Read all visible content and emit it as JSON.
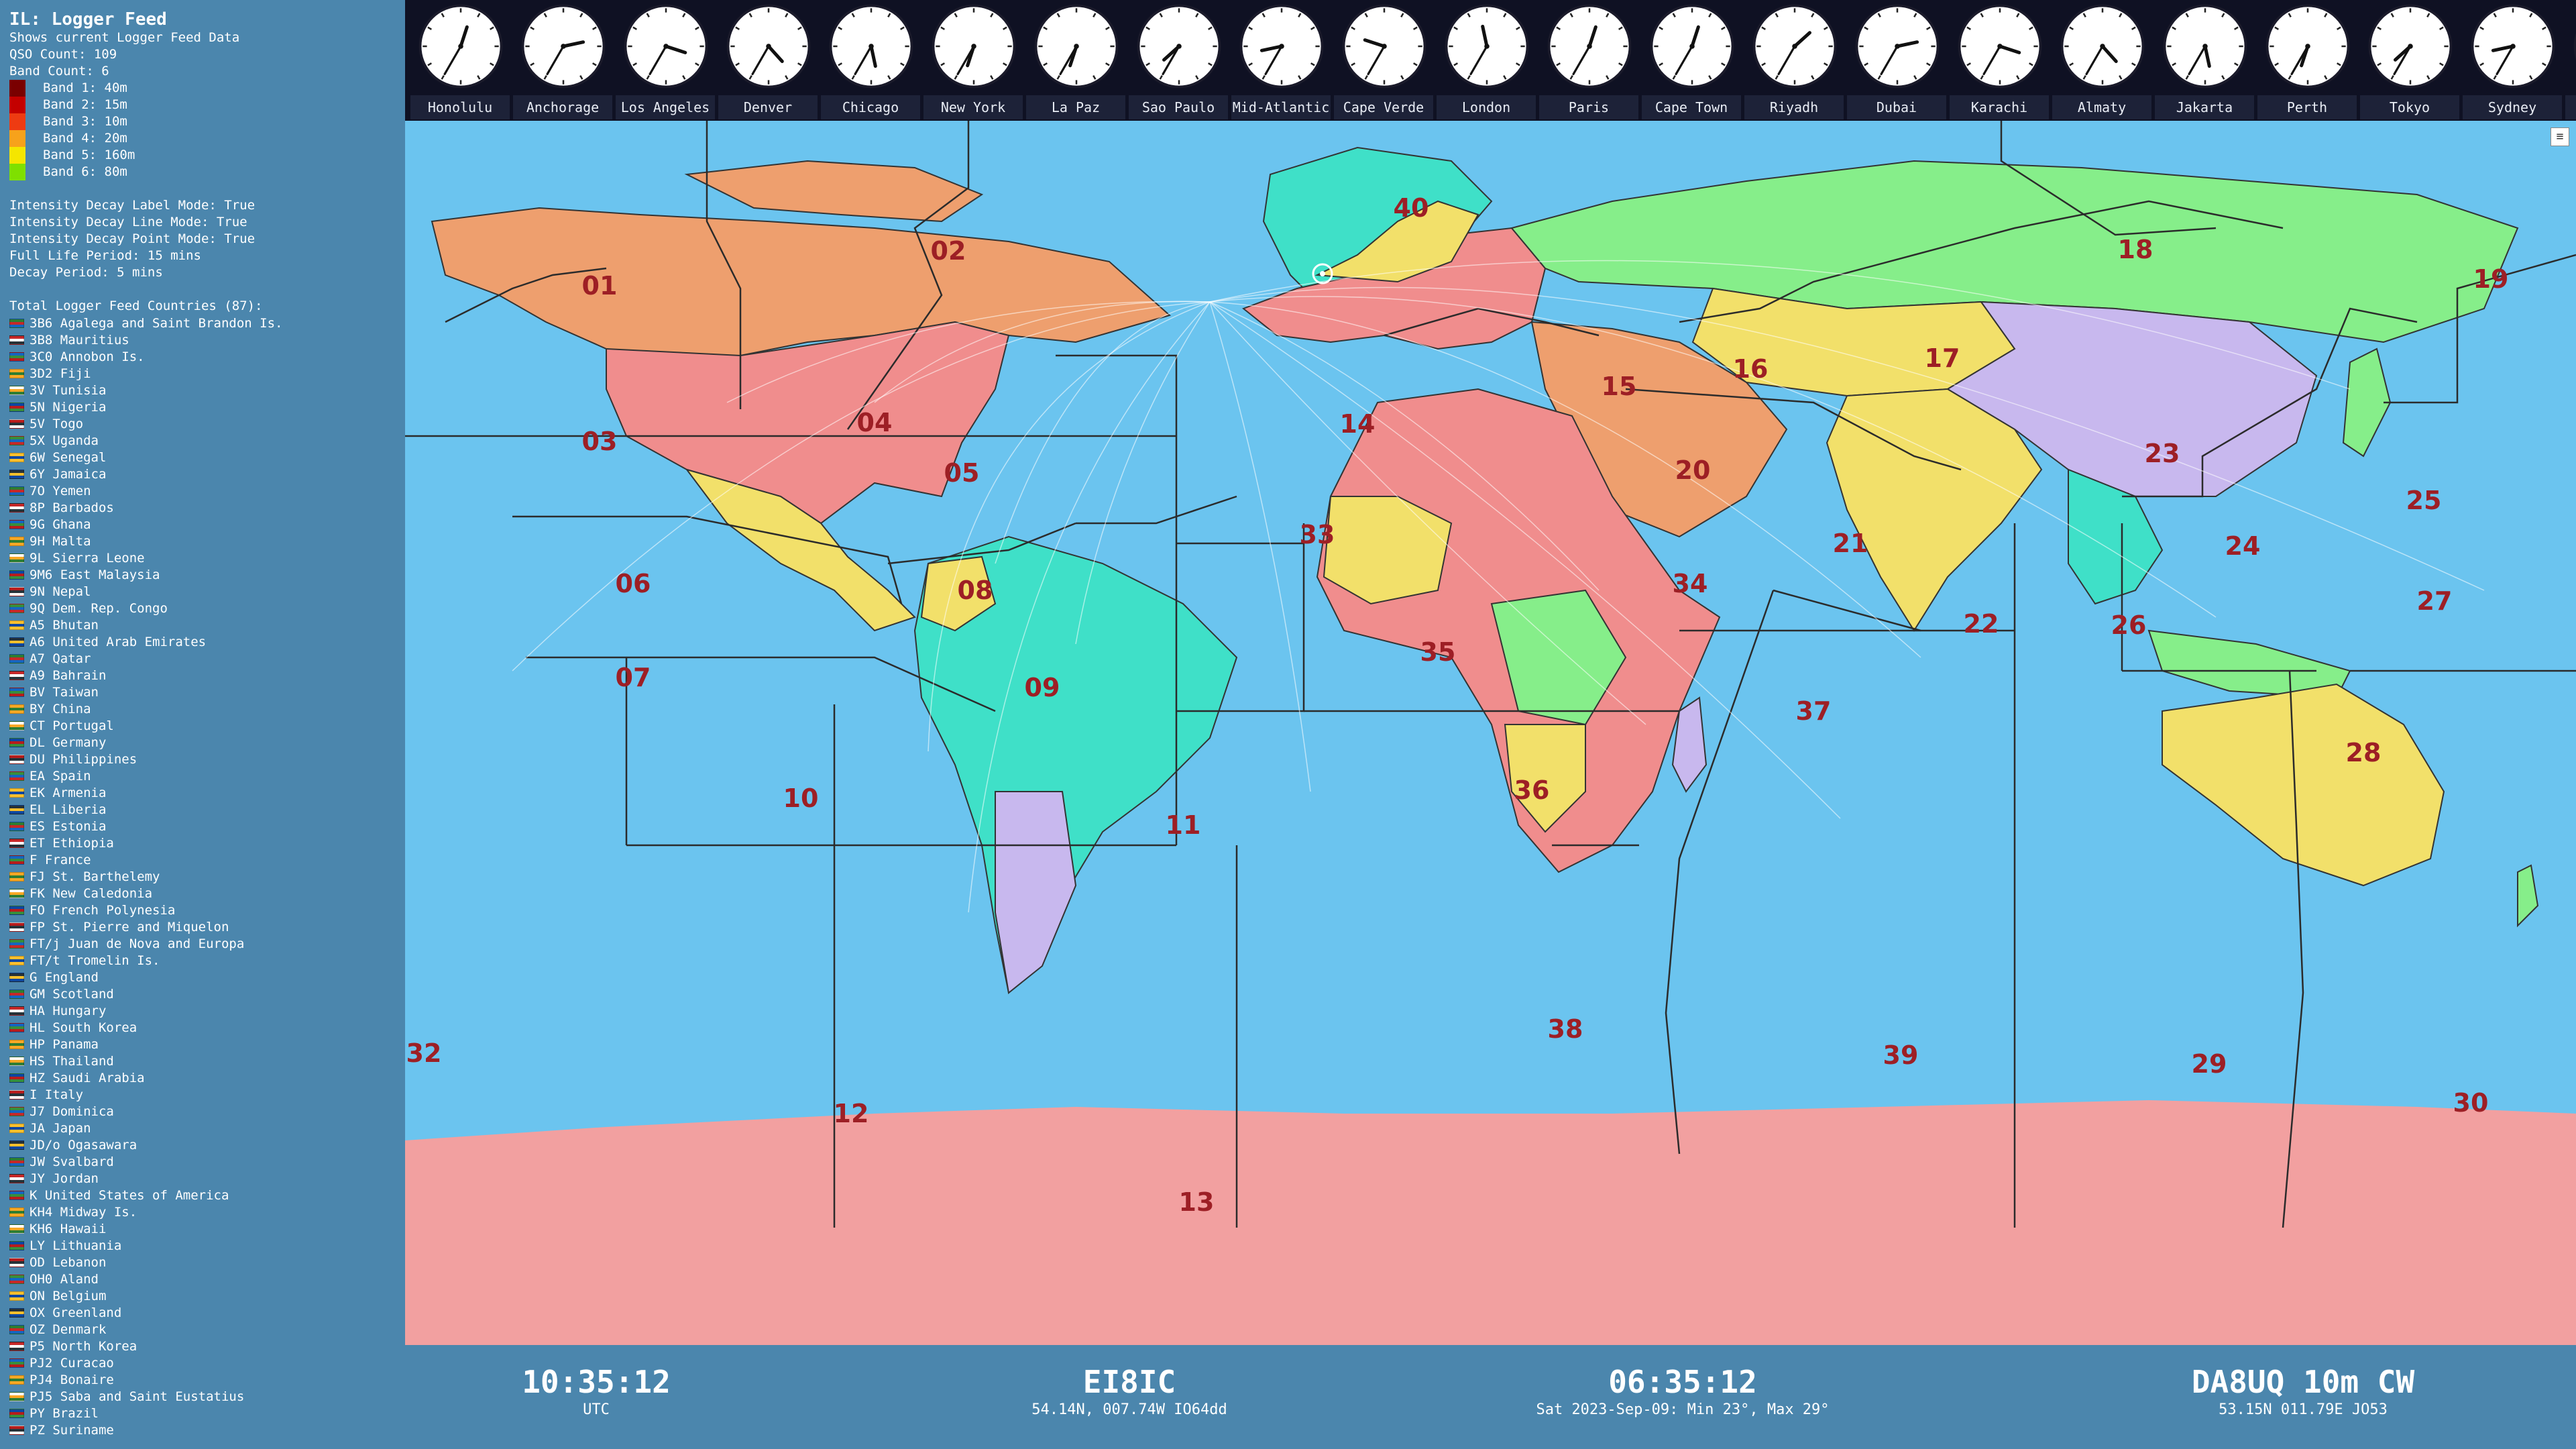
{
  "sidebar": {
    "title": "IL: Logger Feed",
    "subtitle": "Shows current Logger Feed Data",
    "qso_count": "QSO Count: 109",
    "band_count": "Band Count: 6",
    "bands": [
      {
        "label": "Band 1: 40m",
        "color": "#7a0000"
      },
      {
        "label": "Band 2: 15m",
        "color": "#c40000"
      },
      {
        "label": "Band 3: 10m",
        "color": "#ee3b12"
      },
      {
        "label": "Band 4: 20m",
        "color": "#f7a21b"
      },
      {
        "label": "Band 5: 160m",
        "color": "#f5e600"
      },
      {
        "label": "Band 6: 80m",
        "color": "#7fe000"
      }
    ],
    "settings": [
      "Intensity Decay Label Mode: True",
      "Intensity Decay Line Mode: True",
      "Intensity Decay Point Mode: True",
      "Full Life Period: 15 mins",
      "Decay Period: 5 mins"
    ],
    "countries_header": "Total Logger Feed Countries (87):",
    "countries": [
      "3B6 Agalega and Saint Brandon Is.",
      "3B8 Mauritius",
      "3C0 Annobon Is.",
      "3D2 Fiji",
      "3V Tunisia",
      "5N Nigeria",
      "5V Togo",
      "5X Uganda",
      "6W Senegal",
      "6Y Jamaica",
      "7O Yemen",
      "8P Barbados",
      "9G Ghana",
      "9H Malta",
      "9L Sierra Leone",
      "9M6 East Malaysia",
      "9N Nepal",
      "9Q Dem. Rep. Congo",
      "A5 Bhutan",
      "A6 United Arab Emirates",
      "A7 Qatar",
      "A9 Bahrain",
      "BV Taiwan",
      "BY China",
      "CT Portugal",
      "DL Germany",
      "DU Philippines",
      "EA Spain",
      "EK Armenia",
      "EL Liberia",
      "ES Estonia",
      "ET Ethiopia",
      "F France",
      "FJ St. Barthelemy",
      "FK New Caledonia",
      "FO French Polynesia",
      "FP St. Pierre and Miquelon",
      "FT/j Juan de Nova and Europa",
      "FT/t Tromelin Is.",
      "G England",
      "GM Scotland",
      "HA Hungary",
      "HL South Korea",
      "HP Panama",
      "HS Thailand",
      "HZ Saudi Arabia",
      "I Italy",
      "J7 Dominica",
      "JA Japan",
      "JD/o Ogasawara",
      "JW Svalbard",
      "JY Jordan",
      "K United States of America",
      "KH4 Midway Is.",
      "KH6 Hawaii",
      "LY Lithuania",
      "OD Lebanon",
      "OH0 Aland",
      "ON Belgium",
      "OX Greenland",
      "OZ Denmark",
      "P5 North Korea",
      "PJ2 Curacao",
      "PJ4 Bonaire",
      "PJ5 Saba and Saint Eustatius",
      "PY Brazil",
      "PZ Suriname"
    ],
    "flag_colors": [
      "#2e7d32",
      "#c62828",
      "#1565c0",
      "#f9a825",
      "#ffffff",
      "#0d47a1",
      "#b71c1c",
      "#388e3c",
      "#fbc02d",
      "#263238"
    ]
  },
  "clocks": [
    {
      "name": "Honolulu",
      "h": 0.6,
      "m": 35
    },
    {
      "name": "Anchorage",
      "h": 2.6,
      "m": 35
    },
    {
      "name": "Los Angeles",
      "h": 3.6,
      "m": 35
    },
    {
      "name": "Denver",
      "h": 4.6,
      "m": 35
    },
    {
      "name": "Chicago",
      "h": 5.6,
      "m": 35
    },
    {
      "name": "New York",
      "h": 6.6,
      "m": 35
    },
    {
      "name": "La Paz",
      "h": 6.6,
      "m": 35
    },
    {
      "name": "Sao Paulo",
      "h": 7.6,
      "m": 35
    },
    {
      "name": "Mid-Atlantic",
      "h": 8.6,
      "m": 35
    },
    {
      "name": "Cape Verde",
      "h": 9.6,
      "m": 35
    },
    {
      "name": "London",
      "h": 11.6,
      "m": 35
    },
    {
      "name": "Paris",
      "h": 12.6,
      "m": 35
    },
    {
      "name": "Cape Town",
      "h": 12.6,
      "m": 35
    },
    {
      "name": "Riyadh",
      "h": 1.6,
      "m": 35
    },
    {
      "name": "Dubai",
      "h": 2.6,
      "m": 35
    },
    {
      "name": "Karachi",
      "h": 3.6,
      "m": 35
    },
    {
      "name": "Almaty",
      "h": 4.6,
      "m": 35
    },
    {
      "name": "Jakarta",
      "h": 5.6,
      "m": 35
    },
    {
      "name": "Perth",
      "h": 6.6,
      "m": 35
    },
    {
      "name": "Tokyo",
      "h": 7.6,
      "m": 35
    },
    {
      "name": "Sydney",
      "h": 8.6,
      "m": 35
    },
    {
      "name": "V",
      "h": 10.6,
      "m": 35
    }
  ],
  "zones": [
    {
      "n": "01"
    },
    {
      "n": "02"
    },
    {
      "n": "03"
    },
    {
      "n": "04"
    },
    {
      "n": "05"
    },
    {
      "n": "06"
    },
    {
      "n": "07"
    },
    {
      "n": "08"
    },
    {
      "n": "09"
    },
    {
      "n": "10"
    },
    {
      "n": "11"
    },
    {
      "n": "12"
    },
    {
      "n": "13"
    },
    {
      "n": "14"
    },
    {
      "n": "15"
    },
    {
      "n": "16"
    },
    {
      "n": "17"
    },
    {
      "n": "18"
    },
    {
      "n": "19"
    },
    {
      "n": "20"
    },
    {
      "n": "21"
    },
    {
      "n": "22"
    },
    {
      "n": "23"
    },
    {
      "n": "24"
    },
    {
      "n": "25"
    },
    {
      "n": "26"
    },
    {
      "n": "27"
    },
    {
      "n": "28"
    },
    {
      "n": "29"
    },
    {
      "n": "30"
    },
    {
      "n": "32"
    },
    {
      "n": "33"
    },
    {
      "n": "34"
    },
    {
      "n": "35"
    },
    {
      "n": "36"
    },
    {
      "n": "37"
    },
    {
      "n": "38"
    },
    {
      "n": "39"
    },
    {
      "n": "40"
    }
  ],
  "footer": {
    "utc_time": "10:35:12",
    "utc_label": "UTC",
    "callsign": "EI8IC",
    "callsign_loc": "54.14N, 007.74W  IO64dd",
    "local_time": "06:35:12",
    "local_info": "Sat 2023-Sep-09: Min 23°, Max 29°",
    "last_qso": "DA8UQ 10m CW",
    "last_qso_loc": "53.15N 011.79E JO53"
  }
}
